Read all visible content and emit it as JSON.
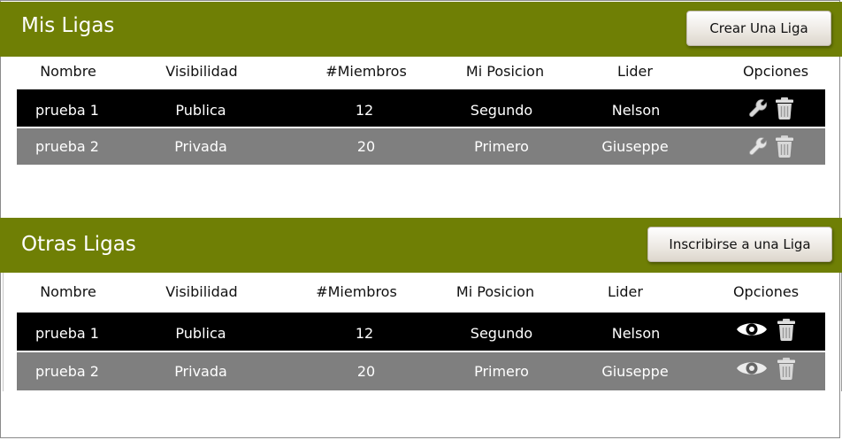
{
  "mis_ligas": {
    "title": "Mis Ligas",
    "button": "Crear Una Liga",
    "columns": [
      "Nombre",
      "Visibilidad",
      "#Miembros",
      "Mi Posicion",
      "Lider",
      "Opciones"
    ],
    "rows": [
      {
        "nombre": "prueba 1",
        "visibilidad": "Publica",
        "miembros": "12",
        "posicion": "Segundo",
        "lider": "Nelson",
        "opciones": [
          "wrench-icon",
          "trash-icon"
        ]
      },
      {
        "nombre": "prueba 2",
        "visibilidad": "Privada",
        "miembros": "20",
        "posicion": "Primero",
        "lider": "Giuseppe",
        "opciones": [
          "wrench-icon",
          "trash-icon"
        ]
      }
    ]
  },
  "otras_ligas": {
    "title": "Otras Ligas",
    "button": "Inscribirse a una Liga",
    "columns": [
      "Nombre",
      "Visibilidad",
      "#Miembros",
      "Mi Posicion",
      "Lider",
      "Opciones"
    ],
    "rows": [
      {
        "nombre": "prueba 1",
        "visibilidad": "Publica",
        "miembros": "12",
        "posicion": "Segundo",
        "lider": "Nelson",
        "opciones": [
          "eye-icon",
          "trash-icon"
        ]
      },
      {
        "nombre": "prueba 2",
        "visibilidad": "Privada",
        "miembros": "20",
        "posicion": "Primero",
        "lider": "Giuseppe",
        "opciones": [
          "eye-icon",
          "trash-icon"
        ]
      }
    ]
  },
  "colors": {
    "header_bar": "#6f7f05",
    "row_dark": "#000000",
    "row_gray": "#7f7f7f"
  }
}
